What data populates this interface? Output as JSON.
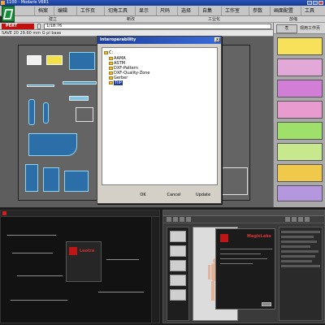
{
  "window": {
    "title": "1100 - Modaris V6R1"
  },
  "menu": [
    "档案",
    "编辑",
    "工作页",
    "切角工具",
    "显示",
    "尺码",
    "选择",
    "自集",
    "工作室",
    "参数",
    "画面配置",
    "工具"
  ],
  "subbar": [
    "建立",
    "断改",
    "工业化",
    "放缩"
  ],
  "pert": {
    "label": "PERT",
    "field1": "",
    "field2": "1/18.76"
  },
  "status": {
    "text": "SAVE 20   29.60 mm G   pl  base"
  },
  "right_panel": {
    "button": "⎘",
    "label": "现用工作页"
  },
  "dialog": {
    "title": "Interoperability",
    "close": "x",
    "root": "C:",
    "items": [
      "AAMA",
      "ASTM",
      "DXF-Pattern",
      "DXF-Quality-Zone",
      "Gerber",
      "TIIP"
    ],
    "selected_index": 5,
    "buttons": {
      "ok": "OK",
      "cancel": "Cancel",
      "update": "Update"
    }
  },
  "bottom_left": {
    "brand": "Leotra"
  },
  "bottom_right": {
    "brand": "MagicLabs"
  }
}
